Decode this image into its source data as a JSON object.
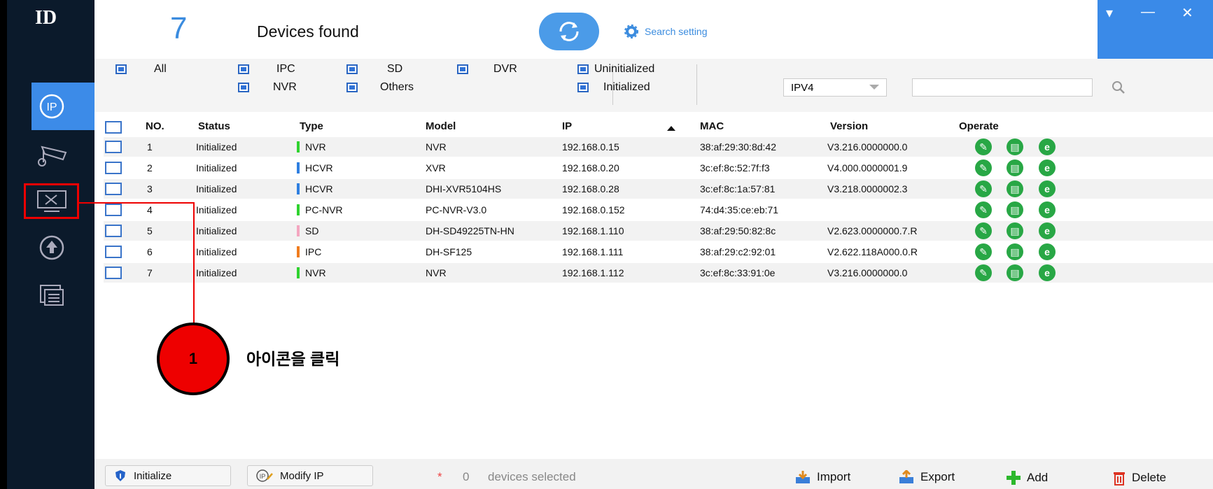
{
  "app": {
    "logo": "ID",
    "device_count": "7",
    "devices_found_label": "Devices found",
    "search_setting_label": "Search setting"
  },
  "window_controls": [
    "▾",
    "—",
    "✕"
  ],
  "sidebar": {
    "items": [
      {
        "icon": "ip-icon",
        "active": true
      },
      {
        "icon": "camera-settings-icon",
        "active": false
      },
      {
        "icon": "tools-icon",
        "active": false
      },
      {
        "icon": "upgrade-icon",
        "active": false
      },
      {
        "icon": "documents-icon",
        "active": false
      }
    ]
  },
  "filters": {
    "all": "All",
    "ipc": "IPC",
    "sd": "SD",
    "dvr": "DVR",
    "nvr": "NVR",
    "others": "Others",
    "uninitialized": "Uninitialized",
    "initialized": "Initialized",
    "ip_version": "IPV4",
    "search_value": ""
  },
  "table": {
    "headers": [
      "NO.",
      "Status",
      "Type",
      "Model",
      "IP",
      "MAC",
      "Version",
      "Operate"
    ],
    "rows": [
      {
        "no": "1",
        "status": "Initialized",
        "type": "NVR",
        "type_color": "#2fd22f",
        "model": "NVR",
        "ip": "192.168.0.15",
        "mac": "38:af:29:30:8d:42",
        "version": "V3.216.0000000.0"
      },
      {
        "no": "2",
        "status": "Initialized",
        "type": "HCVR",
        "type_color": "#2f7fe0",
        "model": "XVR",
        "ip": "192.168.0.20",
        "mac": "3c:ef:8c:52:7f:f3",
        "version": "V4.000.0000001.9"
      },
      {
        "no": "3",
        "status": "Initialized",
        "type": "HCVR",
        "type_color": "#2f7fe0",
        "model": "DHI-XVR5104HS",
        "ip": "192.168.0.28",
        "mac": "3c:ef:8c:1a:57:81",
        "version": "V3.218.0000002.3"
      },
      {
        "no": "4",
        "status": "Initialized",
        "type": "PC-NVR",
        "type_color": "#2fd22f",
        "model": "PC-NVR-V3.0",
        "ip": "192.168.0.152",
        "mac": "74:d4:35:ce:eb:71",
        "version": ""
      },
      {
        "no": "5",
        "status": "Initialized",
        "type": "SD",
        "type_color": "#f4a6c0",
        "model": "DH-SD49225TN-HN",
        "ip": "192.168.1.110",
        "mac": "38:af:29:50:82:8c",
        "version": "V2.623.0000000.7.R"
      },
      {
        "no": "6",
        "status": "Initialized",
        "type": "IPC",
        "type_color": "#f07c1e",
        "model": "DH-SF125",
        "ip": "192.168.1.111",
        "mac": "38:af:29:c2:92:01",
        "version": "V2.622.118A000.0.R"
      },
      {
        "no": "7",
        "status": "Initialized",
        "type": "NVR",
        "type_color": "#2fd22f",
        "model": "NVR",
        "ip": "192.168.1.112",
        "mac": "3c:ef:8c:33:91:0e",
        "version": "V3.216.0000000.0"
      }
    ]
  },
  "annotation": {
    "number": "1",
    "text": "아이콘을 클릭"
  },
  "bottom": {
    "initialize": "Initialize",
    "modify_ip": "Modify IP",
    "asterisk": "*",
    "selected_count": "0",
    "selected_label": "devices selected",
    "import": "Import",
    "export": "Export",
    "add": "Add",
    "delete": "Delete"
  }
}
